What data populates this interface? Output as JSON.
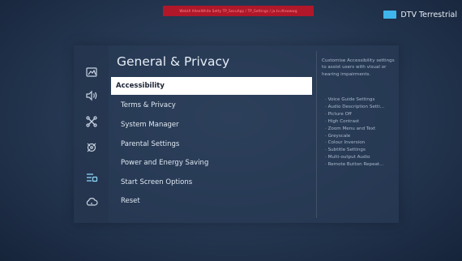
{
  "debug_bar": "WebUI AlleeWhite Setty TP_SecuApp / TP_Settings / ja.tv.dtvwwwg",
  "source": {
    "label": "DTV Terrestrial",
    "color": "#3fb6ec"
  },
  "rail": {
    "icons": [
      "picture-icon",
      "sound-icon",
      "broadcasting-icon",
      "support-icon",
      "general-icon",
      "connection-icon"
    ]
  },
  "panel": {
    "title": "General & Privacy",
    "menu": [
      {
        "label": "Accessibility",
        "selected": true
      },
      {
        "label": "Terms & Privacy"
      },
      {
        "label": "System Manager"
      },
      {
        "label": "Parental Settings"
      },
      {
        "label": "Power and Energy Saving"
      },
      {
        "label": "Start Screen Options"
      },
      {
        "label": "Reset"
      }
    ]
  },
  "description": {
    "text": "Customise Accessibility settings to assist users with visual or hearing impairments.",
    "items": [
      "Voice Guide Settings",
      "Audio Description Setti...",
      "Picture Off",
      "High Contrast",
      "Zoom Menu and Text",
      "Greyscale",
      "Colour Inversion",
      "Subtitle Settings",
      "Multi-output Audio",
      "Remote Button Repeat..."
    ]
  },
  "colors": {
    "accent": "#8fdcff",
    "selected_bg": "#ffffff",
    "error_bar": "#b0182a"
  }
}
